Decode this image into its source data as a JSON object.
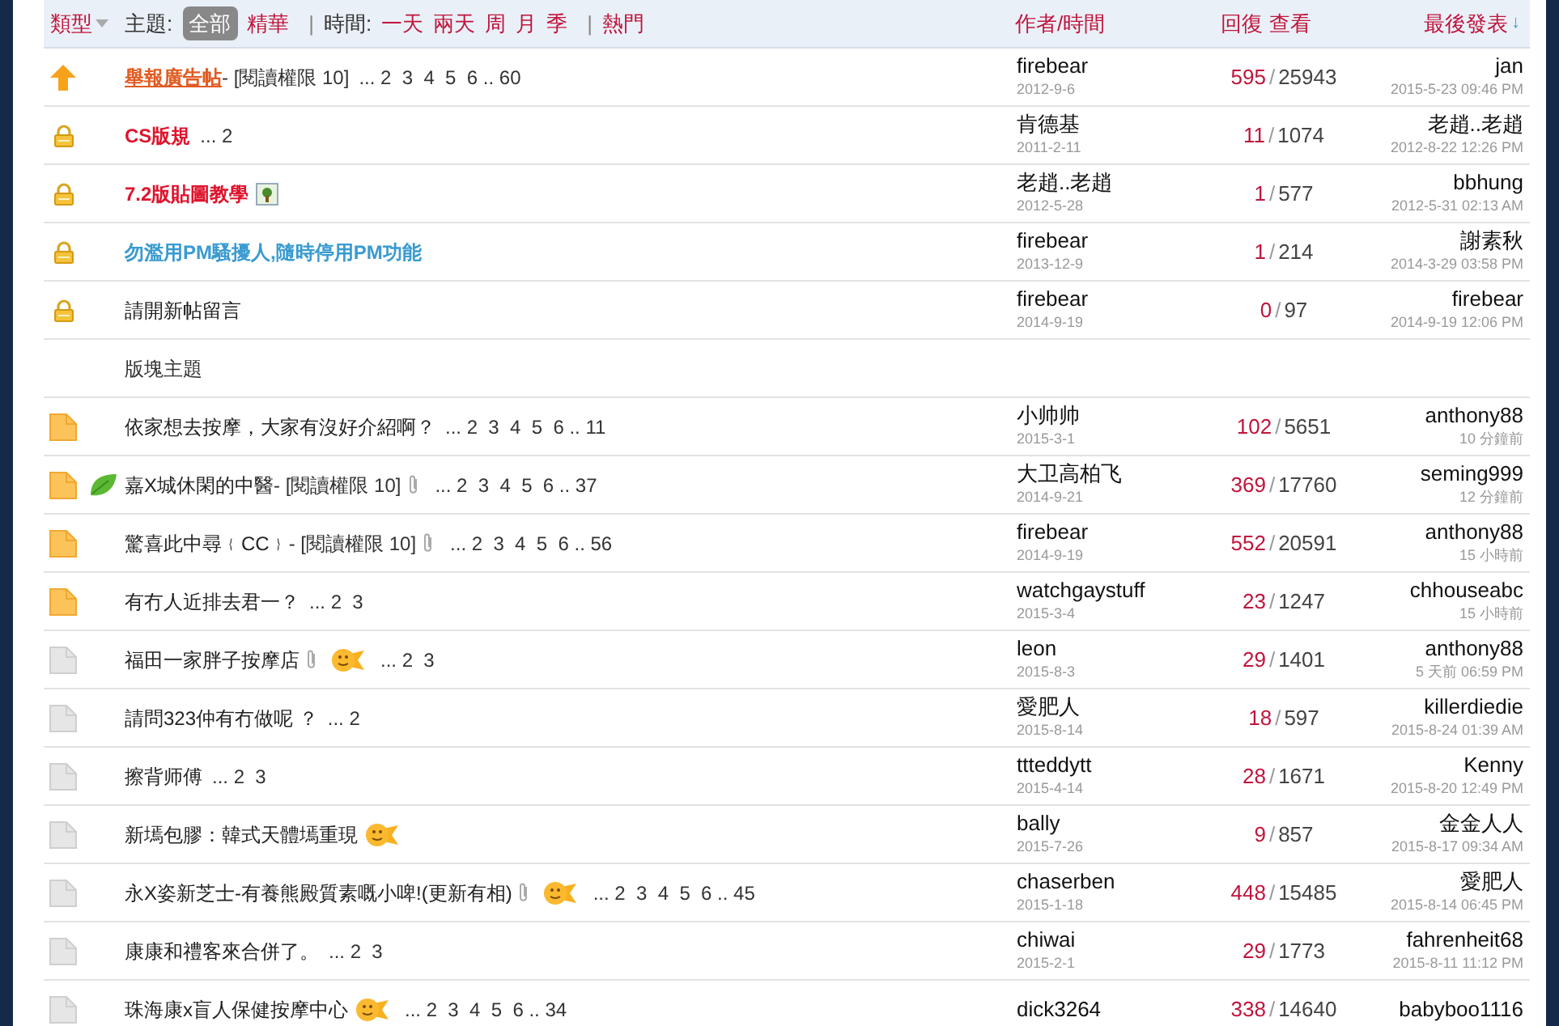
{
  "header": {
    "type_label": "類型",
    "topic_label": "主題:",
    "topic_filters": [
      {
        "label": "全部",
        "selected": true
      },
      {
        "label": "精華",
        "selected": false
      }
    ],
    "separators": [
      "|",
      "|"
    ],
    "time_label": "時間:",
    "time_filters": [
      "一天",
      "兩天",
      "周",
      "月",
      "季"
    ],
    "hot_label": "熱門",
    "author_col": "作者/時間",
    "replies_col": "回復",
    "views_col": "查看",
    "last_col": "最後發表",
    "sort_arrow": "↓"
  },
  "rows": [
    {
      "kind": "pinned",
      "title": "舉報廣告帖",
      "bold": true,
      "underline": true,
      "color": "#e25b22",
      "suffix": " - [閱讀權限 10]",
      "pages": "... 2  3  4  5  6 .. 60",
      "author": "firebear",
      "date": "2012-9-6",
      "replies": "595",
      "separator": "/",
      "views": "25943",
      "last_user": "jan",
      "last_time": "2015-5-23 09:46 PM"
    },
    {
      "kind": "locked",
      "title": "CS版規",
      "bold": true,
      "underline": false,
      "color": "#e0142d",
      "pages": "... 2",
      "author": "肯德基",
      "date": "2011-2-11",
      "replies": "11",
      "separator": "/",
      "views": "1074",
      "last_user": "老趙..老趙",
      "last_time": "2012-8-22 12:26 PM"
    },
    {
      "kind": "locked",
      "title": "7.2版貼圖教學",
      "bold": true,
      "underline": false,
      "color": "#e0142d",
      "image": true,
      "author": "老趙..老趙",
      "date": "2012-5-28",
      "replies": "1",
      "separator": "/",
      "views": "577",
      "last_user": "bbhung",
      "last_time": "2012-5-31 02:13 AM"
    },
    {
      "kind": "locked",
      "title": "勿濫用PM騷擾人,隨時停用PM功能",
      "bold": true,
      "underline": false,
      "color": "#3a9bd0",
      "author": "firebear",
      "date": "2013-12-9",
      "replies": "1",
      "separator": "/",
      "views": "214",
      "last_user": "謝素秋",
      "last_time": "2014-3-29 03:58 PM"
    },
    {
      "kind": "locked",
      "title": "請開新帖留言",
      "bold": false,
      "underline": false,
      "author": "firebear",
      "date": "2014-9-19",
      "replies": "0",
      "separator": "/",
      "views": "97",
      "last_user": "firebear",
      "last_time": "2014-9-19 12:06 PM"
    },
    {
      "kind": "section",
      "title": "版塊主題"
    },
    {
      "kind": "hot",
      "title": "依家想去按摩，大家有沒好介紹啊？",
      "bold": false,
      "underline": false,
      "pages": "... 2  3  4  5  6 .. 11",
      "author": "小帅帅",
      "date": "2015-3-1",
      "replies": "102",
      "separator": "/",
      "views": "5651",
      "last_user": "anthony88",
      "last_time": "10 分鐘前"
    },
    {
      "kind": "hot",
      "leaf": true,
      "title": "嘉X城休閑的中醫",
      "bold": false,
      "underline": false,
      "suffix": " - [閱讀權限 10]",
      "attachment": true,
      "pages": "... 2  3  4  5  6 .. 37",
      "author": "大卫高柏飞",
      "date": "2014-9-21",
      "replies": "369",
      "separator": "/",
      "views": "17760",
      "last_user": "seming999",
      "last_time": "12 分鐘前"
    },
    {
      "kind": "hot",
      "title": "驚喜此中尋﹛CC﹜",
      "bold": false,
      "underline": false,
      "suffix": " - [閱讀權限 10]",
      "attachment": true,
      "pages": "... 2  3  4  5  6 .. 56",
      "author": "firebear",
      "date": "2014-9-19",
      "replies": "552",
      "separator": "/",
      "views": "20591",
      "last_user": "anthony88",
      "last_time": "15 小時前"
    },
    {
      "kind": "hot",
      "title": "有冇人近排去君一？",
      "bold": false,
      "underline": false,
      "pages": "... 2  3",
      "author": "watchgaystuff",
      "date": "2015-3-4",
      "replies": "23",
      "separator": "/",
      "views": "1247",
      "last_user": "chhouseabc",
      "last_time": "15 小時前"
    },
    {
      "kind": "normal",
      "title": "福田一家胖子按摩店",
      "bold": false,
      "underline": false,
      "attachment": true,
      "emoticon": true,
      "pages": "... 2  3",
      "author": "leon",
      "date": "2015-8-3",
      "replies": "29",
      "separator": "/",
      "views": "1401",
      "last_user": "anthony88",
      "last_time": "5 天前 06:59 PM"
    },
    {
      "kind": "normal",
      "title": "請問323仲有冇做呢 ？",
      "bold": false,
      "underline": false,
      "pages": "... 2",
      "author": "愛肥人",
      "date": "2015-8-14",
      "replies": "18",
      "separator": "/",
      "views": "597",
      "last_user": "killerdiedie",
      "last_time": "2015-8-24 01:39 AM"
    },
    {
      "kind": "normal",
      "title": "擦背师傅",
      "bold": false,
      "underline": false,
      "pages": "... 2  3",
      "author": "ttteddytt",
      "date": "2015-4-14",
      "replies": "28",
      "separator": "/",
      "views": "1671",
      "last_user": "Kenny",
      "last_time": "2015-8-20 12:49 PM"
    },
    {
      "kind": "normal",
      "title": "新墕包膠：韓式天體墕重現",
      "bold": false,
      "underline": false,
      "emoticon": true,
      "author": "bally",
      "date": "2015-7-26",
      "replies": "9",
      "separator": "/",
      "views": "857",
      "last_user": "金金人人",
      "last_time": "2015-8-17 09:34 AM"
    },
    {
      "kind": "normal",
      "title": "永X姿新芝士-有養熊殿質素嘅小啤!(更新有相)",
      "bold": false,
      "underline": false,
      "attachment": true,
      "emoticon": true,
      "pages": "... 2  3  4  5  6 .. 45",
      "author": "chaserben",
      "date": "2015-1-18",
      "replies": "448",
      "separator": "/",
      "views": "15485",
      "last_user": "愛肥人",
      "last_time": "2015-8-14 06:45 PM"
    },
    {
      "kind": "normal",
      "title": "康康和禮客來合併了。",
      "bold": false,
      "underline": false,
      "pages": "... 2  3",
      "author": "chiwai",
      "date": "2015-2-1",
      "replies": "29",
      "separator": "/",
      "views": "1773",
      "last_user": "fahrenheit68",
      "last_time": "2015-8-11 11:12 PM"
    },
    {
      "kind": "normal",
      "title": "珠海康x盲人保健按摩中心",
      "bold": false,
      "underline": false,
      "emoticon": true,
      "pages": "... 2  3  4  5  6 .. 34",
      "author": "dick3264",
      "replies": "338",
      "separator": "/",
      "views": "14640",
      "last_user": "babyboo1116"
    }
  ]
}
